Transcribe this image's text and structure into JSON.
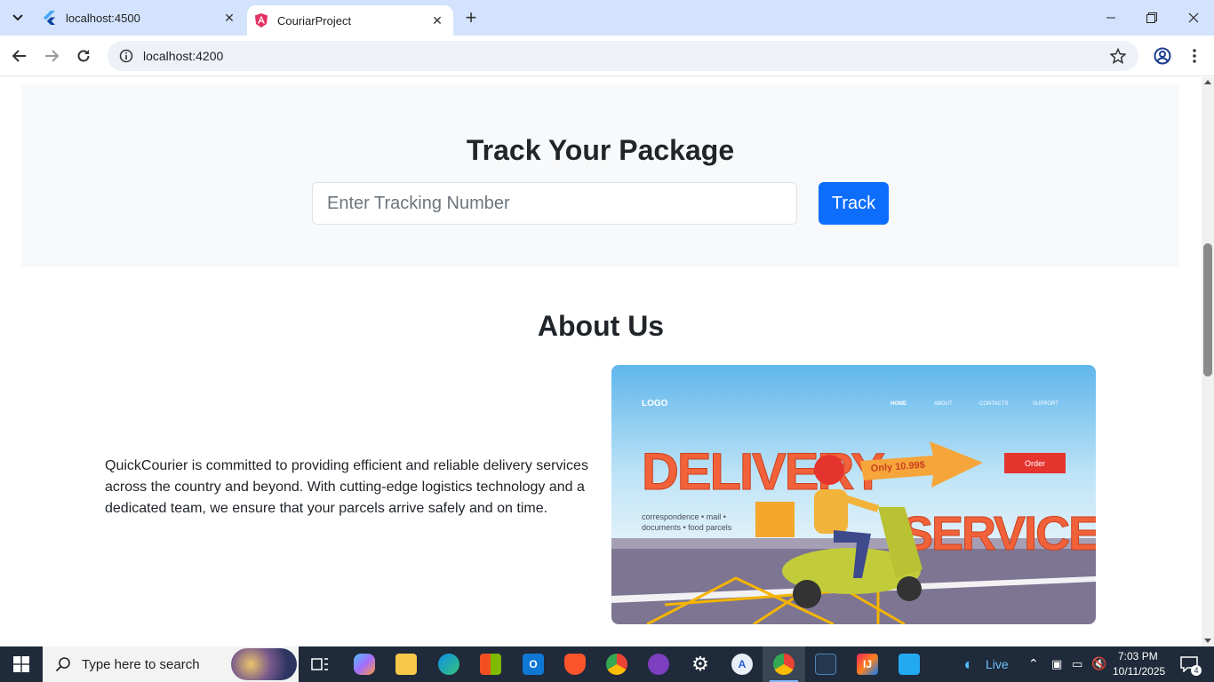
{
  "browser": {
    "tabs": [
      {
        "title": "localhost:4500",
        "active": false
      },
      {
        "title": "CouriarProject",
        "active": true
      }
    ],
    "address": "localhost:4200"
  },
  "track": {
    "title": "Track Your Package",
    "input_placeholder": "Enter Tracking Number",
    "button_label": "Track"
  },
  "about": {
    "title": "About Us",
    "text": "QuickCourier is committed to providing efficient and reliable delivery services across the country and beyond. With cutting-edge logistics technology and a dedicated team, we ensure that your parcels arrive safely and on time.",
    "banner": {
      "logo": "LOGO",
      "nav": [
        "HOME",
        "ABOUT",
        "CONTACTS",
        "SUPPORT"
      ],
      "headline1": "DELIVERY",
      "headline2": "SERVICE",
      "price_tag": "Only 10.99$",
      "order_label": "Order",
      "tagline1": "correspondence • mail •",
      "tagline2": "documents • food parcels"
    }
  },
  "taskbar": {
    "search_placeholder": "Type here to search",
    "live_label": "Live",
    "time": "7:03 PM",
    "date": "10/11/2025",
    "notification_count": "4"
  },
  "colors": {
    "primary": "#0d6efd",
    "section_bg": "#f8f9fa",
    "tabbar_bg": "#d3e3fd"
  }
}
